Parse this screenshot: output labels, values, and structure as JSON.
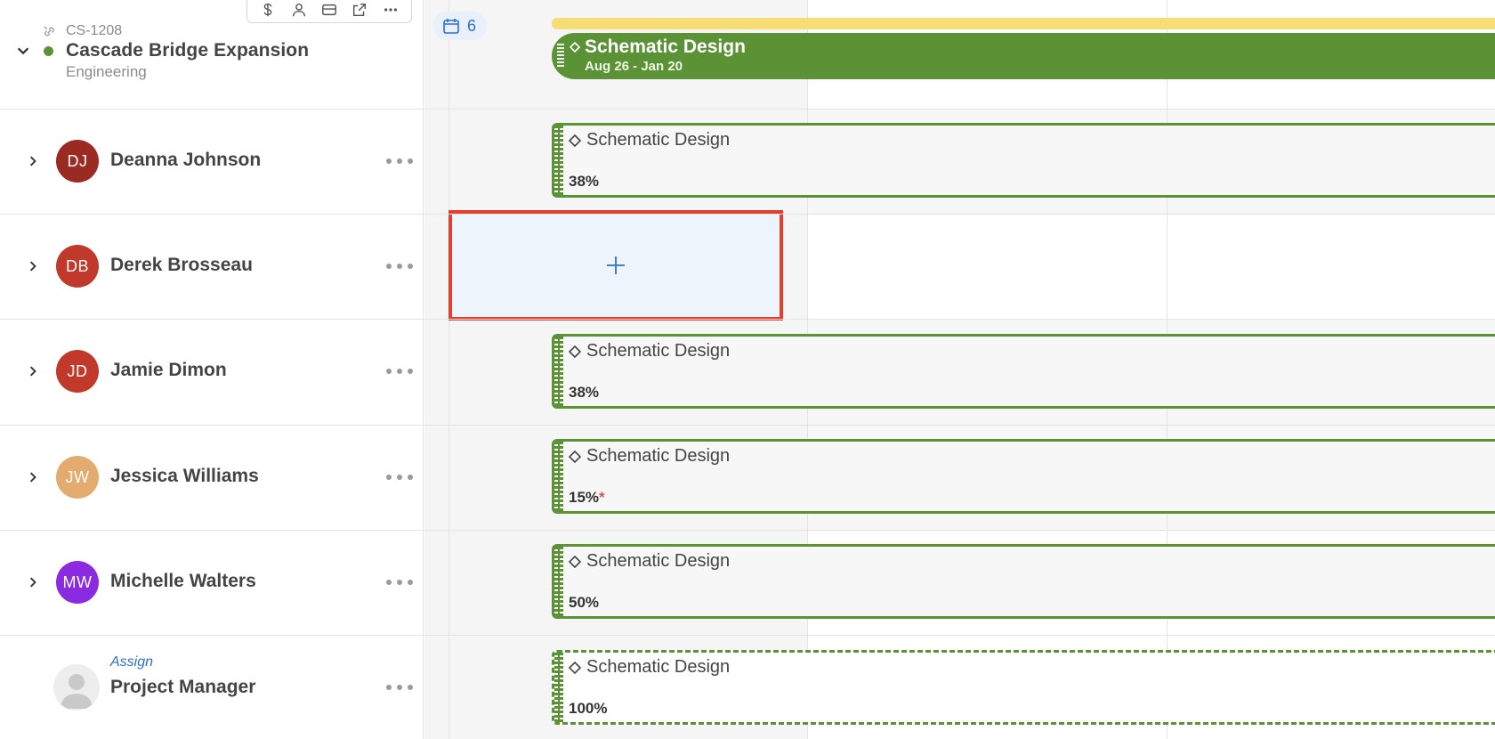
{
  "project": {
    "code": "CS-1208",
    "name": "Cascade Bridge Expansion",
    "department": "Engineering",
    "status_color": "#5b9236",
    "toolbar_icons": [
      "dollar-icon",
      "person-icon",
      "card-icon",
      "external-link-icon",
      "more-icon"
    ]
  },
  "timeline": {
    "count_badge": "6",
    "phase": {
      "name": "Schematic Design",
      "dates": "Aug 26 - Jan 20",
      "color": "#5b9236"
    },
    "milestone_bar_color": "#f8dc74"
  },
  "people": [
    {
      "initials": "DJ",
      "name": "Deanna Johnson",
      "avatar_color": "#9b2a22",
      "task": "Schematic Design",
      "percent": "38%"
    },
    {
      "initials": "DB",
      "name": "Derek Brosseau",
      "avatar_color": "#c0392b"
    },
    {
      "initials": "JD",
      "name": "Jamie Dimon",
      "avatar_color": "#c0392b",
      "task": "Schematic Design",
      "percent": "38%"
    },
    {
      "initials": "JW",
      "name": "Jessica Williams",
      "avatar_color": "#e3ab6e",
      "task": "Schematic Design",
      "percent": "15%",
      "flag": "*"
    },
    {
      "initials": "MW",
      "name": "Michelle Walters",
      "avatar_color": "#8a2be2",
      "task": "Schematic Design",
      "percent": "50%"
    }
  ],
  "unassigned": {
    "assign_label": "Assign",
    "role": "Project Manager",
    "task": "Schematic Design",
    "percent": "100%"
  }
}
